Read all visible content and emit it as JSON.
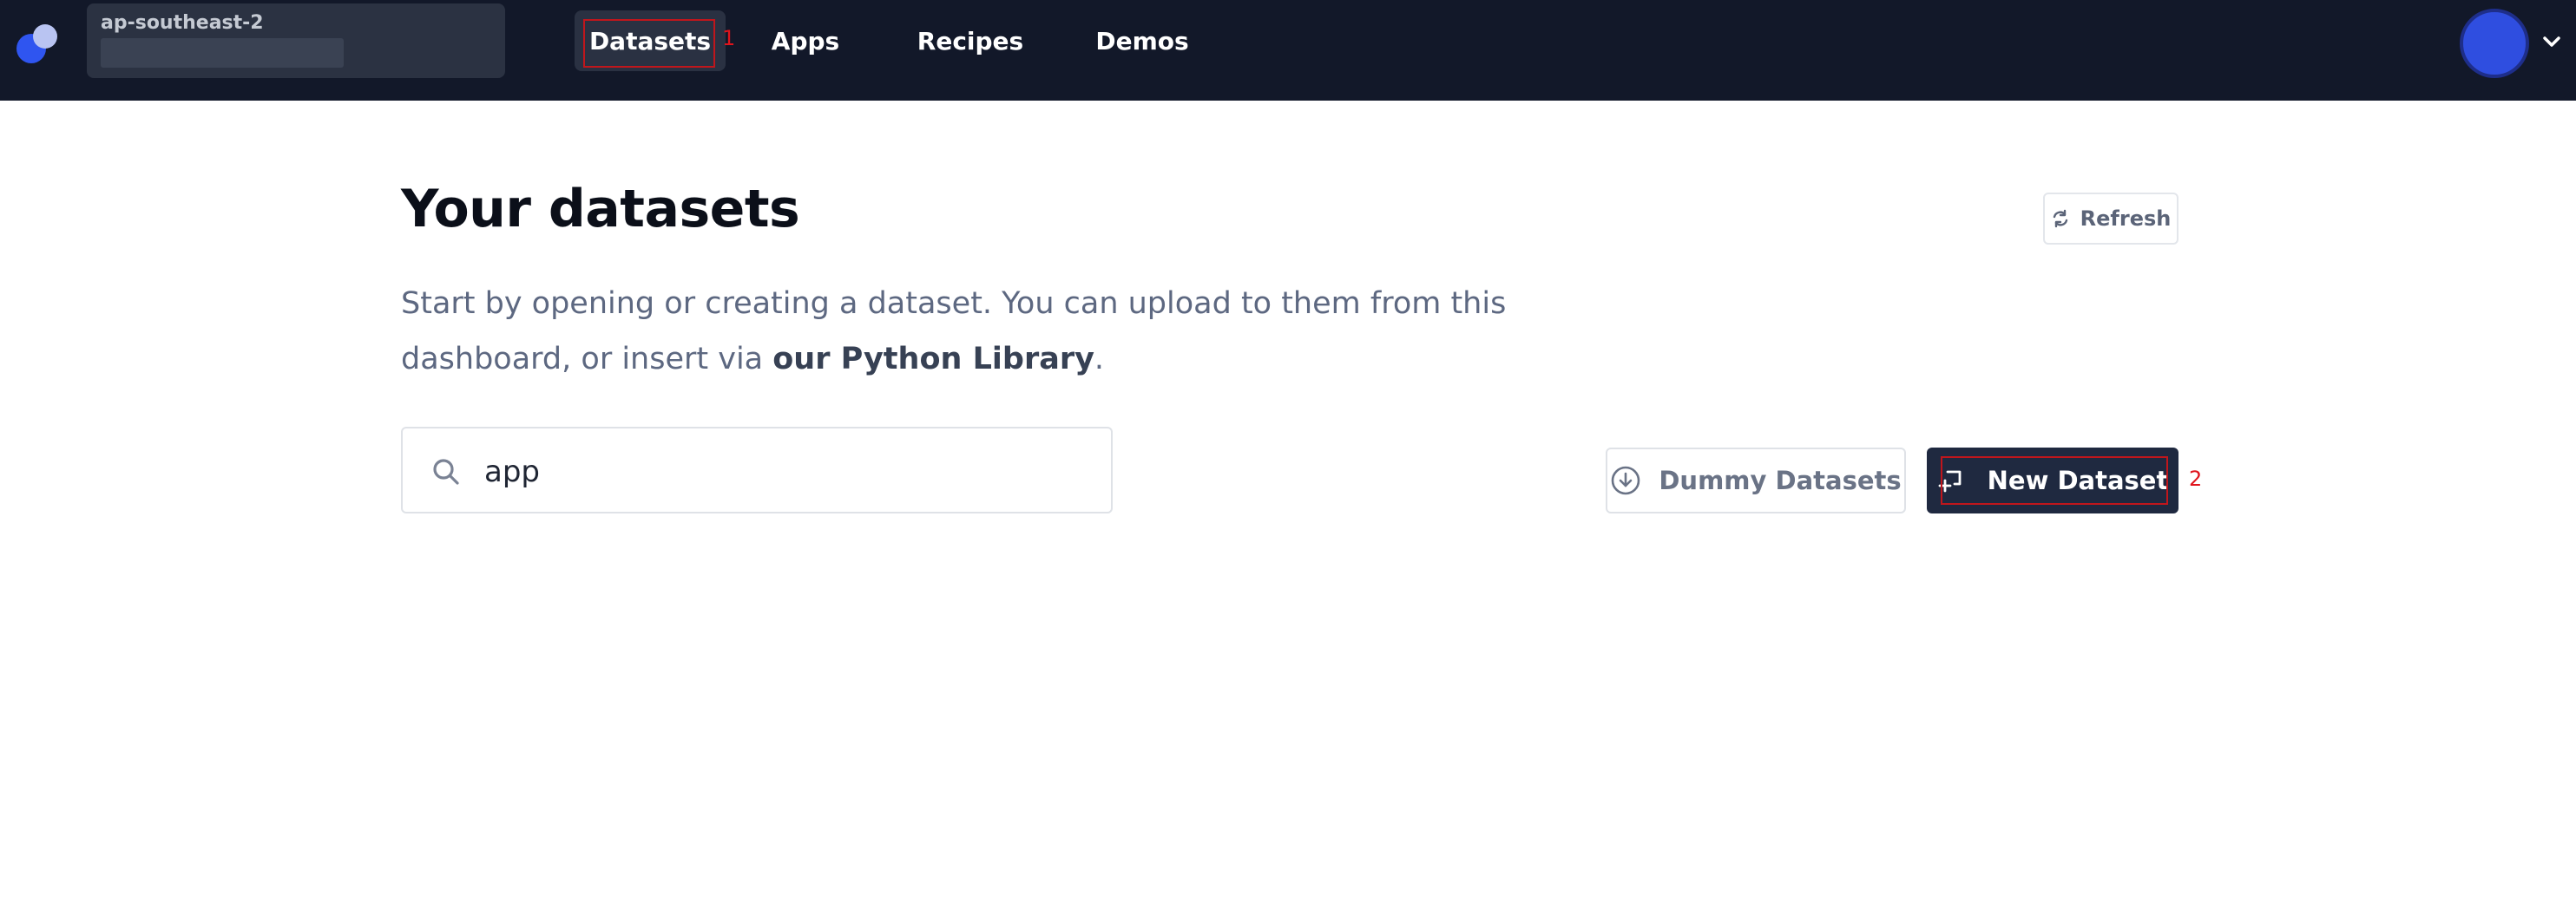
{
  "header": {
    "region_label": "ap-southeast-2",
    "nav": [
      {
        "label": "Datasets",
        "active": true
      },
      {
        "label": "Apps",
        "active": false
      },
      {
        "label": "Recipes",
        "active": false
      },
      {
        "label": "Demos",
        "active": false
      }
    ],
    "annotation_1": "1"
  },
  "main": {
    "title": "Your datasets",
    "intro_text": "Start by opening or creating a dataset. You can upload to them from this dashboard, or insert via ",
    "intro_link": "our Python Library",
    "intro_end": ".",
    "refresh_label": "Refresh",
    "search": {
      "value": "app"
    },
    "dummy_label": "Dummy Datasets",
    "new_label": "New Dataset",
    "annotation_2": "2"
  },
  "colors": {
    "topbar": "#121829",
    "accent_blue": "#2f4ee0",
    "primary_button": "#1f2940",
    "annotation": "#e0141c"
  },
  "icons": [
    "logo-icon",
    "chevron-down-icon",
    "refresh-icon",
    "search-icon",
    "download-circle-icon",
    "new-dataset-icon"
  ]
}
